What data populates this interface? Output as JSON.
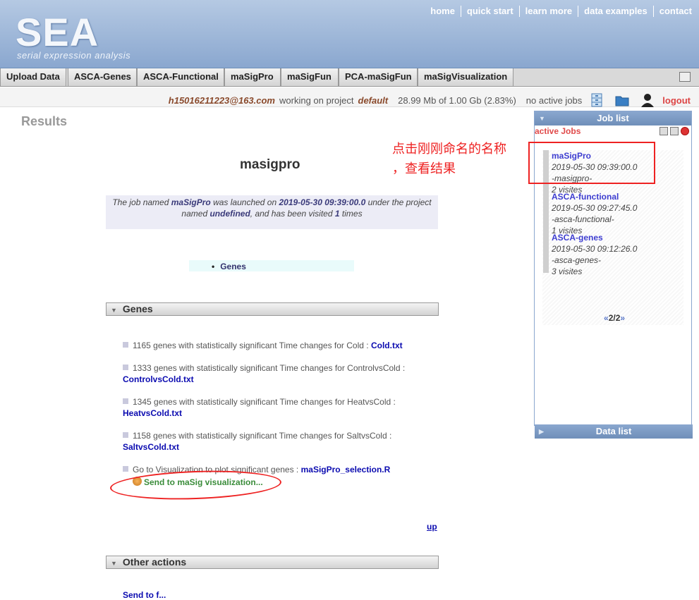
{
  "header": {
    "logo": "SEA",
    "logo_sub": "serial expression analysis",
    "links": [
      "home",
      "quick start",
      "learn more",
      "data examples",
      "contact"
    ]
  },
  "tabs": [
    "Upload Data",
    "ASCA-Genes",
    "ASCA-Functional",
    "maSigPro",
    "maSigFun",
    "PCA-maSigFun",
    "maSigVisualization"
  ],
  "userbar": {
    "email": "h15016211223@163.com",
    "working_text": "working on project",
    "project": "default",
    "storage": "28.99 Mb of 1.00 Gb (2.83%)",
    "jobs_status": "no active jobs",
    "logout": "logout"
  },
  "main": {
    "results_title": "Results",
    "job_heading": "masigpro",
    "job_info": {
      "t1": "The job named ",
      "job_name": "maSigPro",
      "t2": " was launched on ",
      "date": "2019-05-30 09:39:00.0",
      "t3": " under the project named ",
      "project": "undefined",
      "t4": ", and has been visited ",
      "visits": "1",
      "t5": " times"
    },
    "genes_link": "Genes",
    "genes_section": "Genes",
    "gene_items": [
      {
        "text": "1165 genes with statistically significant Time changes for Cold : ",
        "file": "Cold.txt"
      },
      {
        "text": "1333 genes with statistically significant Time changes for ControlvsCold : ",
        "file": "ControlvsCold.txt"
      },
      {
        "text": "1345 genes with statistically significant Time changes for HeatvsCold : ",
        "file": "HeatvsCold.txt"
      },
      {
        "text": "1158 genes with statistically significant Time changes for SaltvsCold : ",
        "file": "SaltvsCold.txt"
      },
      {
        "text": "Go to Visualization to plot significant genes : ",
        "file": "maSigPro_selection.R"
      }
    ],
    "send_button": "Send to maSig visualization...",
    "up_link": "up",
    "other_actions_section": "Other actions",
    "first_action": "Send to f..."
  },
  "job_panel": {
    "title": "Job list",
    "active_jobs": "active Jobs",
    "jobs": [
      {
        "name": "maSigPro",
        "date": "2019-05-30 09:39:00.0",
        "tag": "-masigpro-",
        "visits": "2 visites"
      },
      {
        "name": "ASCA-functional",
        "date": "2019-05-30 09:27:45.0",
        "tag": "-asca-functional-",
        "visits": "1 visites"
      },
      {
        "name": "ASCA-genes",
        "date": "2019-05-30 09:12:26.0",
        "tag": "-asca-genes-",
        "visits": "3 visites"
      }
    ],
    "pager": "2/2",
    "data_list_title": "Data list"
  },
  "annotation": {
    "line1": "点击刚刚命名的名称",
    "line2": "，查看结果"
  },
  "colors": {
    "header_bg": "#8aa7cf",
    "annotation_red": "#e22",
    "link_blue": "#0b0bb0",
    "user_brown": "#8a4a2c"
  }
}
